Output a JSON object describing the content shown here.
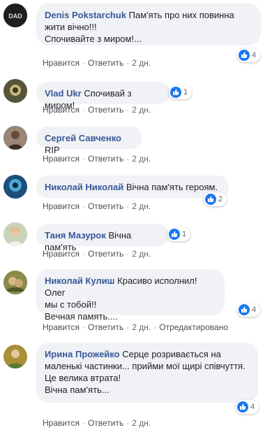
{
  "comments": [
    {
      "author": "Denis Pokstarchuk",
      "text": "Пам'ять про них повинна жити вічно!!!\nСпочивайте з миром!...",
      "reactions": "4",
      "actions": [
        "Нравится",
        "Ответить",
        "2 дн."
      ]
    },
    {
      "author": "Vlad Ukr",
      "text": "Спочивай з миром!",
      "reactions": "1",
      "actions": [
        "Нравится",
        "Ответить",
        "2 дн."
      ]
    },
    {
      "author": "Сергей Савченко",
      "text": "RIP",
      "reactions": "",
      "actions": [
        "Нравится",
        "Ответить",
        "2 дн."
      ]
    },
    {
      "author": "Николай Николай",
      "text": "Вічна пам'ять героям.",
      "reactions": "2",
      "actions": [
        "Нравится",
        "Ответить",
        "2 дн."
      ]
    },
    {
      "author": "Таня Мазурок",
      "text": "Вічна пам'ять",
      "reactions": "1",
      "actions": [
        "Нравится",
        "Ответить",
        "2 дн."
      ]
    },
    {
      "author": "Николай Кулиш",
      "text": "Красиво исполнил!Олег мы с тобой!!\nВечная память....",
      "reactions": "4",
      "actions": [
        "Нравится",
        "Ответить",
        "2 дн.",
        "Отредактировано"
      ]
    },
    {
      "author": "Ирина Прожейко",
      "text": "Серце розривається на маленькі частинки... прийми мої щирі співчуття. Це велика втрата!\nВічна пам'ять...",
      "reactions": "4",
      "actions": [
        "Нравится",
        "Ответить",
        "2 дн."
      ]
    }
  ],
  "avatar_colors": [
    "#2a2a2a",
    "#6b6b3a",
    "#7a5a4a",
    "#1d4f7a",
    "#b8c4a8",
    "#7a7a3a",
    "#c8a848"
  ],
  "icons": {
    "reaction": "like-thumb-icon"
  }
}
